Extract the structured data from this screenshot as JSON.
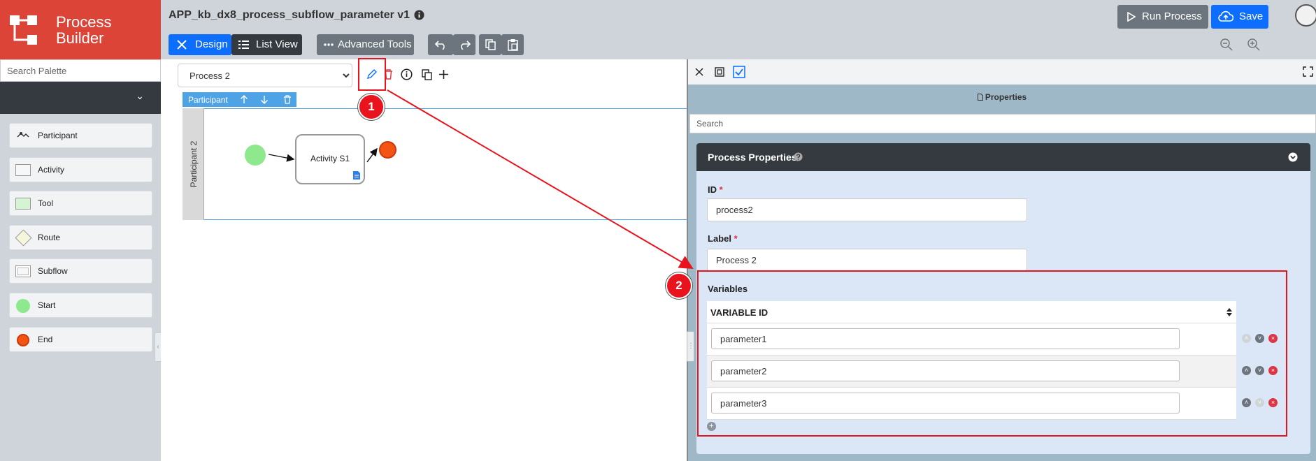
{
  "logo": {
    "line1": "Process",
    "line2": "Builder"
  },
  "palette": {
    "search_placeholder": "Search Palette",
    "items": [
      {
        "label": "Participant",
        "icon": "participant-icon"
      },
      {
        "label": "Activity",
        "icon": "activity-icon"
      },
      {
        "label": "Tool",
        "icon": "tool-icon"
      },
      {
        "label": "Route",
        "icon": "route-icon"
      },
      {
        "label": "Subflow",
        "icon": "subflow-icon"
      },
      {
        "label": "Start",
        "icon": "start-icon"
      },
      {
        "label": "End",
        "icon": "end-icon"
      }
    ]
  },
  "header": {
    "app_title": "APP_kb_dx8_process_subflow_parameter v1",
    "design_label": "Design",
    "list_view_label": "List View",
    "advanced_tools_label": "Advanced Tools",
    "run_process_label": "Run Process",
    "save_label": "Save"
  },
  "canvas": {
    "process_options": [
      "Process 2"
    ],
    "pool_label": "Participant",
    "lane_label": "Participant 2",
    "activity_label": "Activity S1"
  },
  "properties": {
    "panel_title": "Properties",
    "search_placeholder": "Search",
    "section_title": "Process Properties",
    "id_label": "ID",
    "id_value": "process2",
    "label_label": "Label",
    "label_value": "Process 2",
    "variables_label": "Variables",
    "variable_column": "VARIABLE ID",
    "variables": [
      "parameter1",
      "parameter2",
      "parameter3"
    ],
    "required_mark": "*"
  },
  "annotations": {
    "badge1": "1",
    "badge2": "2"
  },
  "colors": {
    "brand_red": "#db4437",
    "primary_blue": "#0d6efd",
    "annotation_red": "#e8131d",
    "start_green": "#8ee88e",
    "end_orange": "#f35413"
  }
}
